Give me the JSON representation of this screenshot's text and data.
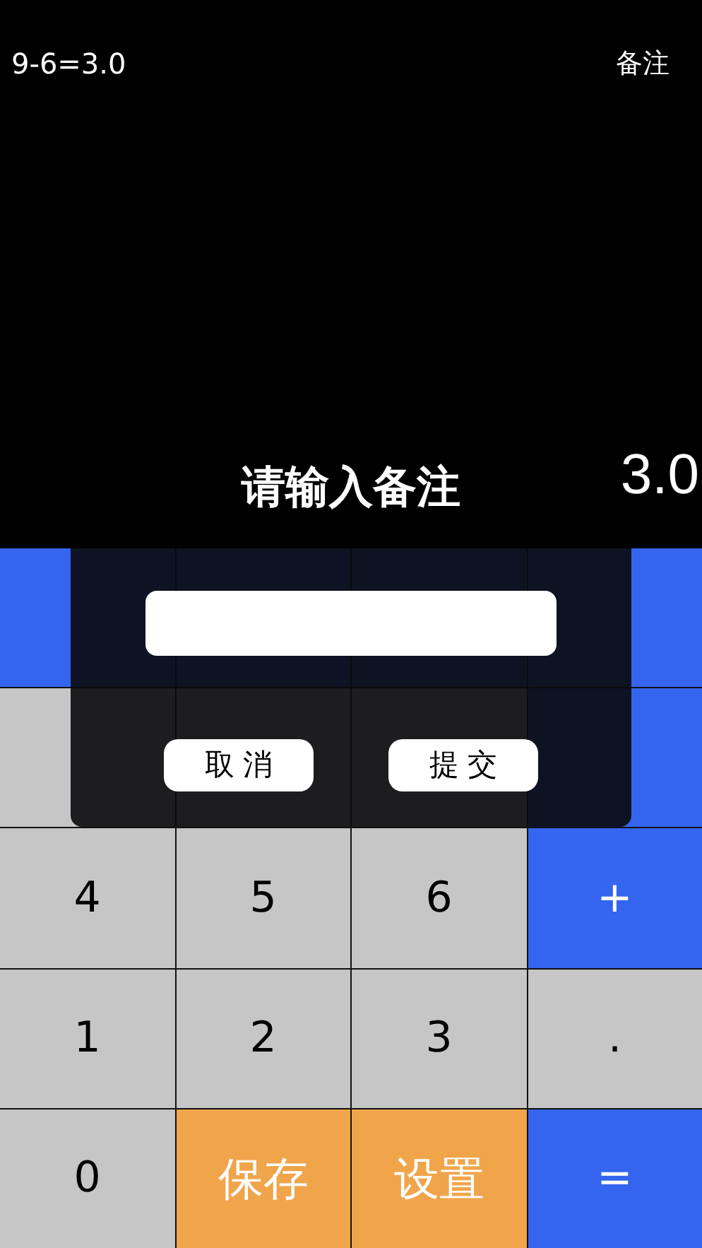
{
  "history": {
    "expression": "9-6=3.0",
    "note_button": "备注"
  },
  "display": "3.0",
  "keypad": [
    [
      {
        "kind": "operator"
      },
      {
        "kind": "operator"
      },
      {
        "kind": "operator"
      },
      {
        "kind": "operator"
      }
    ],
    [
      {
        "kind": "digit"
      },
      {
        "kind": "digit"
      },
      {
        "kind": "digit"
      },
      {
        "kind": "operator"
      }
    ],
    [
      {
        "label": "4",
        "kind": "digit"
      },
      {
        "label": "5",
        "kind": "digit"
      },
      {
        "label": "6",
        "kind": "digit"
      },
      {
        "label": "+",
        "kind": "operator"
      }
    ],
    [
      {
        "label": "1",
        "kind": "digit"
      },
      {
        "label": "2",
        "kind": "digit"
      },
      {
        "label": "3",
        "kind": "digit"
      },
      {
        "label": ".",
        "kind": "digit"
      }
    ],
    [
      {
        "label": "0",
        "kind": "digit"
      },
      {
        "label": "保存",
        "kind": "action"
      },
      {
        "label": "设置",
        "kind": "action"
      },
      {
        "label": "=",
        "kind": "operator"
      }
    ]
  ],
  "dialog": {
    "title": "请输入备注",
    "buttons": [
      "取消",
      "提交"
    ]
  }
}
